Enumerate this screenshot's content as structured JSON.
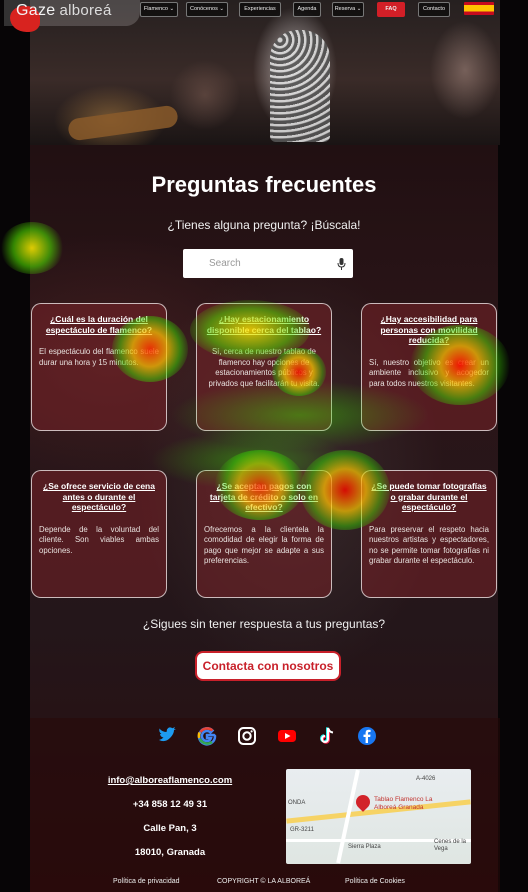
{
  "logo": {
    "brand": "Gaze",
    "name": "alboreá"
  },
  "nav": {
    "items": [
      {
        "label": "Flamenco ⌄"
      },
      {
        "label": "Conócenos ⌄"
      },
      {
        "label": "Experiencias"
      },
      {
        "label": "Agenda"
      },
      {
        "label": "Reserva ⌄"
      },
      {
        "label": "FAQ"
      },
      {
        "label": "Contacto"
      }
    ],
    "language": "ES"
  },
  "hero": {
    "title": "Preguntas frecuentes",
    "subtitle": "¿Tienes alguna pregunta? ¡Búscala!",
    "search_placeholder": "Search"
  },
  "faq": [
    {
      "question": "¿Cuál es la duración del espectáculo de flamenco?",
      "answer": "El espectáculo del flamenco suele durar una hora y 15 minutos."
    },
    {
      "question": "¿Hay estacionamiento disponible cerca del tablao?",
      "answer": "Sí, cerca de nuestro tablao de flamenco hay opciones de estacionamientos públicos y privados que facilitarán tu visita."
    },
    {
      "question": "¿Hay accesibilidad para personas con movilidad reducida?",
      "answer": "Sí, nuestro objetivo es crear un ambiente inclusivo y acogedor para todos nuestros visitantes."
    },
    {
      "question": "¿Se ofrece servicio de cena antes o durante el espectáculo?",
      "answer": "Depende de la voluntad del cliente. Son viables ambas opciones."
    },
    {
      "question": "¿Se aceptan pagos con tarjeta de crédito o solo en efectivo?",
      "answer": "Ofrecemos a la clientela la comodidad de elegir la forma de pago que mejor se adapte a sus preferencias."
    },
    {
      "question": "¿Se puede tomar fotografías o grabar durante el espectáculo?",
      "answer": "Para preservar el respeto hacia nuestros artistas y espectadores, no se permite tomar fotografías ni grabar durante el espectáculo."
    }
  ],
  "cta": {
    "text": "¿Sigues sin tener respuesta a tus preguntas?",
    "button": "Contacta con nosotros"
  },
  "social_icons": [
    "twitter-icon",
    "google-icon",
    "instagram-icon",
    "youtube-icon",
    "tiktok-icon",
    "facebook-icon"
  ],
  "contact": {
    "email": "info@alboreaflamenco.com",
    "phone": "+34 858 12 49 31",
    "street": "Calle Pan, 3",
    "city": "18010, Granada"
  },
  "map": {
    "place": "Tablao Flamenco La Alboreá Granada",
    "area_labels": [
      "ONDA",
      "Sierra Plaza",
      "Cenes de la Vega",
      "A-4026",
      "GR-3211"
    ]
  },
  "footer_links": {
    "privacy": "Política de privacidad",
    "copyright": "COPYRIGHT © LA ALBOREÁ",
    "cookies": "Política de Cookies"
  },
  "colors": {
    "accent": "#d21f27",
    "card_bg": "#78232b",
    "footer_bg": "#280a0a"
  }
}
